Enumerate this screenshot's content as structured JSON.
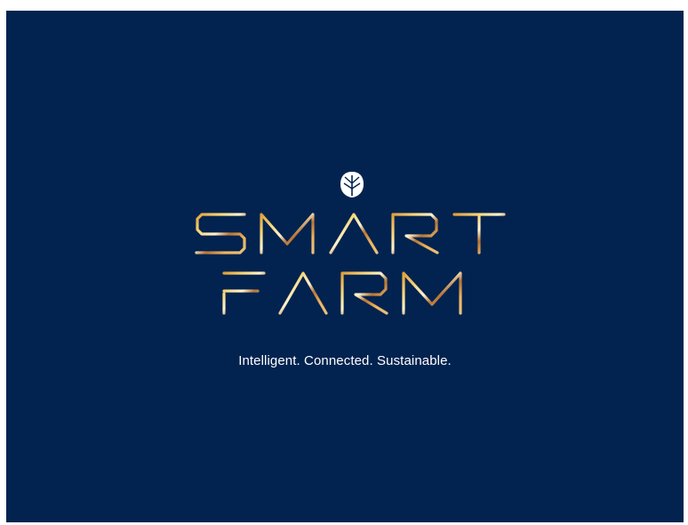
{
  "logo": {
    "wordmark_line1": "SMART",
    "wordmark_line2": "FARM",
    "emblem_icon": "leaf-emblem-icon"
  },
  "tagline": "Intelligent. Connected. Sustainable.",
  "colors": {
    "background": "#022350",
    "rule": "#e9e6df",
    "gradient": [
      "#c98222",
      "#f2c75a",
      "#fff2c2",
      "#b8783c",
      "#e6a85a"
    ]
  }
}
